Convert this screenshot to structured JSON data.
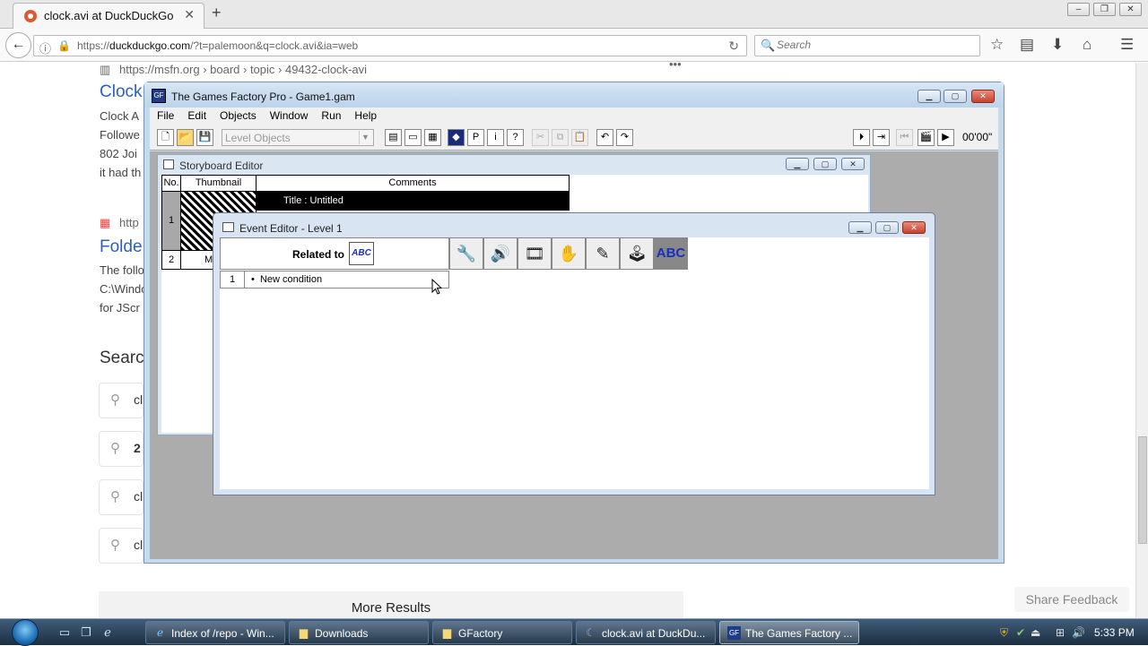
{
  "browser": {
    "tab_title": "clock.avi at DuckDuckGo",
    "url_prefix": "https://",
    "url_domain": "duckduckgo.com",
    "url_rest": "/?t=palemoon&q=clock.avi&ia=web",
    "search_placeholder": "Search"
  },
  "webpage": {
    "result1_url": "https://msfn.org › board › topic › 49432-clock-avi",
    "result1_title": "Clock",
    "result1_snippet": [
      "Clock A",
      "Followe",
      "802 Joi",
      "it had th"
    ],
    "result2_url": "http",
    "result2_title": "Folde",
    "result2_snippet": [
      "The follo",
      "C:\\Windo",
      "for JScr"
    ],
    "related_heading": "Searc",
    "suggestions": [
      "cl",
      "2",
      "cl",
      "cl"
    ],
    "more_results": "More Results",
    "share_feedback": "Share Feedback",
    "ellipsis": "•••"
  },
  "tgf": {
    "title": "The Games Factory Pro - Game1.gam",
    "app_icon": "GF",
    "menu": [
      "File",
      "Edit",
      "Objects",
      "Window",
      "Run",
      "Help"
    ],
    "level_select": "Level Objects",
    "time": "00'00\""
  },
  "storyboard": {
    "title": "Storyboard Editor",
    "headers": [
      "No.",
      "Thumbnail",
      "Comments"
    ],
    "row1_no": "1",
    "row1_comment": "Title : Untitled",
    "row2_no": "2",
    "row2_thumb": "Mo"
  },
  "event_editor": {
    "title": "Event Editor - Level 1",
    "related_to": "Related to",
    "abc_label": "ABC",
    "row_no": "1",
    "row_condition": "New condition",
    "bullet": "•"
  },
  "taskbar": {
    "tasks": [
      {
        "label": "Index of /repo - Win...",
        "icon": "ie-icon"
      },
      {
        "label": "Downloads",
        "icon": "folder-icon"
      },
      {
        "label": "GFactory",
        "icon": "folder-icon"
      },
      {
        "label": "clock.avi at DuckDu...",
        "icon": "palemoon-icon"
      },
      {
        "label": "The Games Factory ...",
        "icon": "tgf-icon"
      }
    ],
    "clock": "5:33 PM"
  }
}
